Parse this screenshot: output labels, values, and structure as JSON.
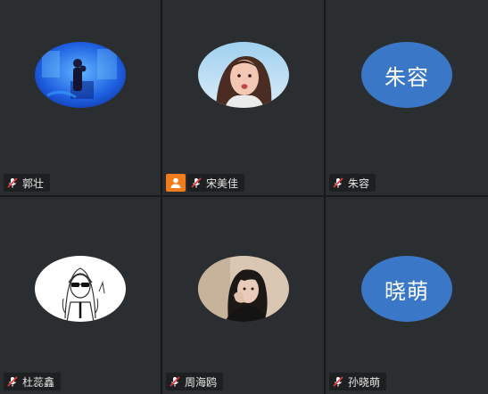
{
  "participants": [
    {
      "name": "郭壮",
      "avatar_type": "photo",
      "avatar_desc": "blue-aquarium-photo",
      "mic": "muted",
      "host": false
    },
    {
      "name": "宋美佳",
      "avatar_type": "photo",
      "avatar_desc": "girl-sky-photo",
      "mic": "muted",
      "host": true
    },
    {
      "name": "朱容",
      "avatar_type": "text",
      "avatar_text": "朱容",
      "mic": "muted",
      "host": false
    },
    {
      "name": "杜蕊鑫",
      "avatar_type": "photo",
      "avatar_desc": "cartoon-drawing",
      "mic": "muted",
      "host": false
    },
    {
      "name": "周海鸥",
      "avatar_type": "photo",
      "avatar_desc": "woman-portrait-photo",
      "mic": "muted",
      "host": false
    },
    {
      "name": "孙晓萌",
      "avatar_type": "text",
      "avatar_text": "晓萌",
      "mic": "muted",
      "host": false
    }
  ],
  "colors": {
    "tile_bg": "#2b2e31",
    "text_avatar_bg": "#3a78c7",
    "host_badge": "#f07c1c",
    "mic_muted": "#e23b3b"
  },
  "icons": {
    "mic": "mic-muted-icon",
    "host": "host-person-icon"
  }
}
